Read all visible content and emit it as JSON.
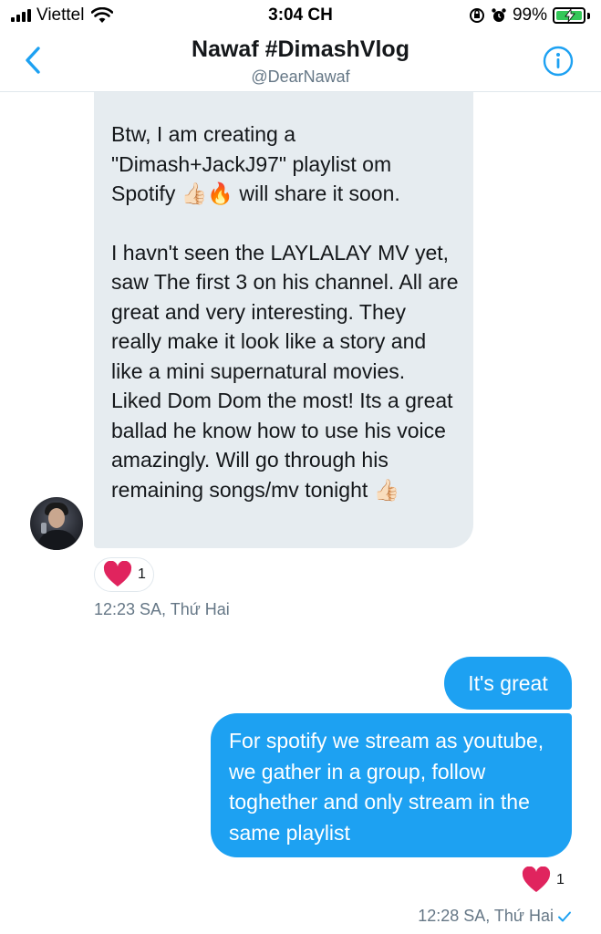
{
  "status_bar": {
    "carrier": "Viettel",
    "time": "3:04 CH",
    "battery_percent_text": "99%",
    "battery_level": 0.99
  },
  "header": {
    "title": "Nawaf #DimashVlog",
    "handle": "@DearNawaf",
    "back_icon": "chevron-left-icon",
    "info_icon": "info-circle-icon"
  },
  "messages": {
    "incoming": {
      "paragraph_1": "Btw, I am creating a \"Dimash+JackJ97\" playlist om Spotify 👍🏻🔥 will share it soon.",
      "paragraph_2": "I havn't seen the LAYLALAY MV yet, saw The first 3 on his channel. All are great and very interesting. They really make it look like a story and like a mini supernatural movies. Liked Dom Dom the most! Its a great ballad he know how to use his voice amazingly. Will go through his remaining songs/mv tonight 👍🏻",
      "reaction_count": "1",
      "timestamp": "12:23 SA, Thứ Hai"
    },
    "outgoing": [
      {
        "text": "It's great"
      },
      {
        "text": "For spotify we stream as youtube, we gather in a group, follow toghether and only stream in the same playlist"
      }
    ],
    "outgoing_reaction_count": "1",
    "outgoing_timestamp": "12:28 SA, Thứ Hai"
  },
  "colors": {
    "accent": "#1da1f2",
    "incoming_bubble": "#e6ecf0",
    "heart": "#e0245e",
    "secondary_text": "#657786",
    "battery": "#34c759"
  }
}
